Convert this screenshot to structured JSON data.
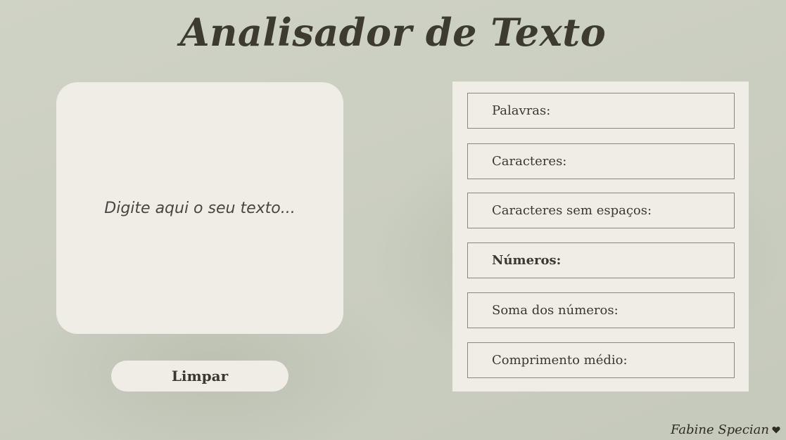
{
  "title": "Analisador de Texto",
  "input": {
    "placeholder": "Digite aqui o seu texto..."
  },
  "clear_button": {
    "label": "Limpar"
  },
  "stats": [
    {
      "label": "Palavras:",
      "value": ""
    },
    {
      "label": "Caracteres:",
      "value": ""
    },
    {
      "label": "Caracteres sem espaços:",
      "value": ""
    },
    {
      "label": "Números:",
      "value": ""
    },
    {
      "label": "Soma dos números:",
      "value": ""
    },
    {
      "label": "Comprimento médio:",
      "value": ""
    }
  ],
  "signature": {
    "text": "Fabine Specian",
    "icon": "heart-icon"
  }
}
